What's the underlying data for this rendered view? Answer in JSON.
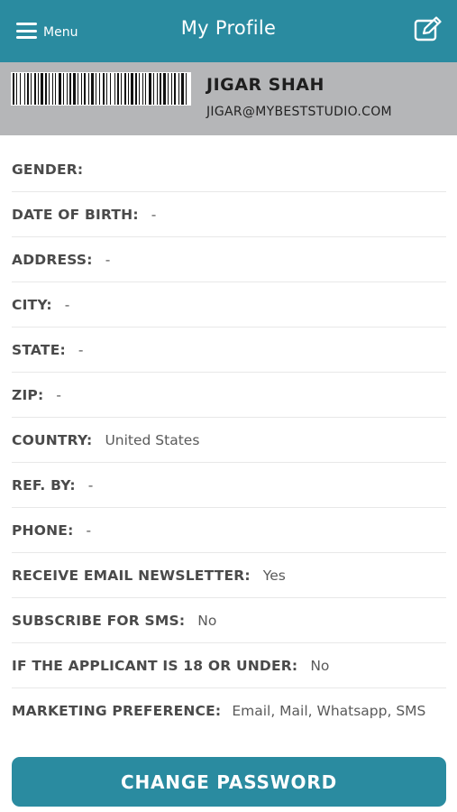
{
  "header": {
    "menu_label": "Menu",
    "title": "My Profile",
    "menu_icon": "hamburger-icon",
    "edit_icon": "edit-icon",
    "background_color": "#2a8ba0"
  },
  "profile": {
    "name": "JIGAR SHAH",
    "email": "JIGAR@MYBESTSTUDIO.COM",
    "barcode_icon": "barcode-icon",
    "background_color": "#b5b6b8"
  },
  "fields": [
    {
      "label": "GENDER:",
      "value": ""
    },
    {
      "label": "DATE OF BIRTH:",
      "value": "-"
    },
    {
      "label": "ADDRESS:",
      "value": "-"
    },
    {
      "label": "CITY:",
      "value": "-"
    },
    {
      "label": "STATE:",
      "value": "-"
    },
    {
      "label": "ZIP:",
      "value": "-"
    },
    {
      "label": "COUNTRY:",
      "value": "United States"
    },
    {
      "label": "REF. BY:",
      "value": "-"
    },
    {
      "label": "PHONE:",
      "value": "-"
    },
    {
      "label": "RECEIVE EMAIL NEWSLETTER:",
      "value": "Yes"
    },
    {
      "label": "SUBSCRIBE FOR SMS:",
      "value": "No"
    },
    {
      "label": "IF THE APPLICANT IS 18 OR UNDER:",
      "value": "No"
    },
    {
      "label": "MARKETING PREFERENCE:",
      "value": "Email, Mail, Whatsapp, SMS"
    }
  ],
  "change_password_button": {
    "label": "CHANGE PASSWORD",
    "background_color": "#2a8ba0"
  }
}
